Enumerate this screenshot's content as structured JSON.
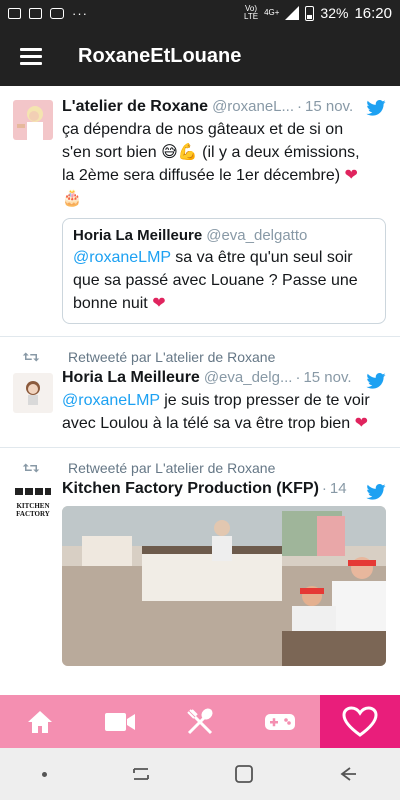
{
  "status_bar": {
    "network_top": "Vo)",
    "network_bottom": "LTE",
    "signal_label": "4G+",
    "battery": "32%",
    "time": "16:20",
    "dots": "···"
  },
  "app_bar": {
    "title": "RoxaneEtLouane"
  },
  "tweets": [
    {
      "name": "L'atelier de Roxane",
      "handle": "@roxaneL...",
      "time": "15 nov.",
      "text_1": "ça dépendra de nos gâteaux et de si on s'en sort bien 😅💪 (il y a deux émissions, la 2ème sera diffusée le 1er décembre) ",
      "text_emoji": "❤🎂",
      "quote": {
        "name": "Horia La Meilleure",
        "handle": "@eva_delgatto",
        "mention": "@roxaneLMP",
        "text": " sa va être qu'un seul soir que sa passé avec Louane ? Passe une bonne nuit ",
        "emoji": "❤"
      }
    },
    {
      "retweet_label": "Retweeté par L'atelier de Roxane",
      "name": "Horia La Meilleure",
      "handle": "@eva_delg...",
      "time": "15 nov.",
      "mention": "@roxaneLMP",
      "text": " je suis trop presser de te voir avec Loulou à la télé sa va être trop bien ",
      "emoji": "❤"
    },
    {
      "retweet_label": "Retweeté par L'atelier de Roxane",
      "name": "Kitchen Factory Production (KFP)",
      "time": "14",
      "logo_text": "KITCHEN FACTORY"
    }
  ],
  "colors": {
    "accent": "#e91e7b",
    "nav_bg": "#f48fb1",
    "link": "#1da1f2",
    "twitter_blue": "#1da1f2"
  },
  "bottom_nav": [
    {
      "icon": "home-icon",
      "active": false
    },
    {
      "icon": "video-camera-icon",
      "active": false
    },
    {
      "icon": "kitchen-utensils-icon",
      "active": false
    },
    {
      "icon": "gamepad-icon",
      "active": false
    },
    {
      "icon": "heart-icon",
      "active": true
    }
  ]
}
